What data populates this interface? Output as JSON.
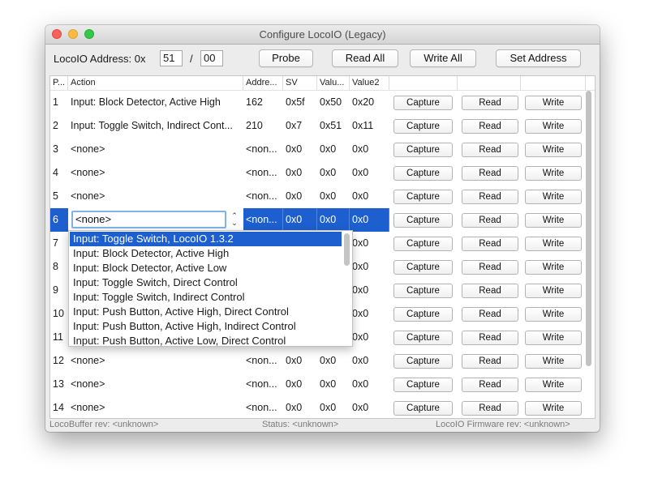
{
  "window": {
    "title": "Configure LocoIO (Legacy)"
  },
  "toolbar": {
    "address_label": "LocoIO Address: 0x",
    "address_high": "51",
    "separator": "/",
    "address_low": "00",
    "probe_label": "Probe",
    "read_all_label": "Read All",
    "write_all_label": "Write All",
    "set_address_label": "Set Address"
  },
  "table": {
    "headers": [
      "P...",
      "Action",
      "Addre...",
      "SV",
      "Valu...",
      "Value2",
      "",
      "",
      ""
    ],
    "capture_label": "Capture",
    "read_label": "Read",
    "write_label": "Write",
    "rows": [
      {
        "port": "1",
        "action": "Input: Block Detector, Active High",
        "address": "162",
        "sv": "0x5f",
        "value": "0x50",
        "value2": "0x20"
      },
      {
        "port": "2",
        "action": "Input: Toggle Switch, Indirect Cont...",
        "address": "210",
        "sv": "0x7",
        "value": "0x51",
        "value2": "0x11"
      },
      {
        "port": "3",
        "action": "<none>",
        "address": "<non...",
        "sv": "0x0",
        "value": "0x0",
        "value2": "0x0"
      },
      {
        "port": "4",
        "action": "<none>",
        "address": "<non...",
        "sv": "0x0",
        "value": "0x0",
        "value2": "0x0"
      },
      {
        "port": "5",
        "action": "<none>",
        "address": "<non...",
        "sv": "0x0",
        "value": "0x0",
        "value2": "0x0"
      },
      {
        "port": "6",
        "action": "<none>",
        "address": "<non...",
        "sv": "0x0",
        "value": "0x0",
        "value2": "0x0",
        "selected": true
      },
      {
        "port": "7",
        "action": "",
        "address": "",
        "sv": "",
        "value": "",
        "value2": "0x0"
      },
      {
        "port": "8",
        "action": "",
        "address": "",
        "sv": "",
        "value": "",
        "value2": "0x0"
      },
      {
        "port": "9",
        "action": "",
        "address": "",
        "sv": "",
        "value": "",
        "value2": "0x0"
      },
      {
        "port": "10",
        "action": "",
        "address": "",
        "sv": "",
        "value": "",
        "value2": "0x0"
      },
      {
        "port": "11",
        "action": "",
        "address": "",
        "sv": "",
        "value": "",
        "value2": "0x0"
      },
      {
        "port": "12",
        "action": "<none>",
        "address": "<non...",
        "sv": "0x0",
        "value": "0x0",
        "value2": "0x0"
      },
      {
        "port": "13",
        "action": "<none>",
        "address": "<non...",
        "sv": "0x0",
        "value": "0x0",
        "value2": "0x0"
      },
      {
        "port": "14",
        "action": "<none>",
        "address": "<non...",
        "sv": "0x0",
        "value": "0x0",
        "value2": "0x0"
      }
    ]
  },
  "dropdown": {
    "current_value": "<none>",
    "options": [
      "Input: Toggle Switch, LocoIO 1.3.2",
      "Input: Block Detector, Active High",
      "Input: Block Detector, Active Low",
      "Input: Toggle Switch, Direct Control",
      "Input: Toggle Switch, Indirect Control",
      "Input: Push Button, Active High, Direct Control",
      "Input: Push Button, Active High, Indirect Control",
      "Input: Push Button, Active Low, Direct Control"
    ],
    "highlighted_index": 0
  },
  "statusbar": {
    "locobuffer": "LocoBuffer rev: <unknown>",
    "status": "Status: <unknown>",
    "firmware": "LocoIO Firmware rev: <unknown>"
  },
  "colors": {
    "selection": "#1d5fcf",
    "focus_ring": "#82b2ea"
  }
}
